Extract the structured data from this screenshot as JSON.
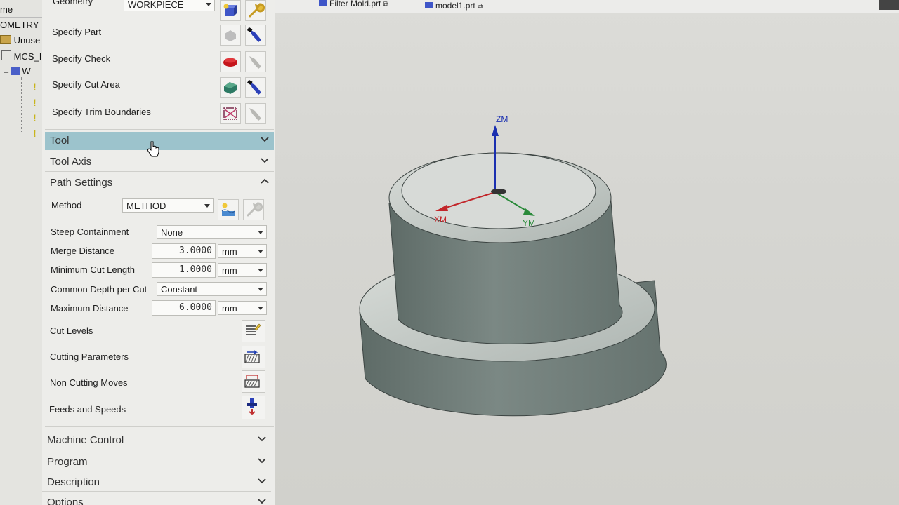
{
  "tree": {
    "items": [
      {
        "label": "me"
      },
      {
        "label": "OMETRY"
      },
      {
        "label": "Unuse"
      },
      {
        "label": "MCS_I"
      },
      {
        "label": "W"
      }
    ]
  },
  "tabs": [
    {
      "label": "Filter Mold.prt"
    },
    {
      "label": "model1.prt"
    }
  ],
  "geometry": {
    "label": "Geometry",
    "value": "WORKPIECE",
    "specify": [
      {
        "label": "Specify Part"
      },
      {
        "label": "Specify Check"
      },
      {
        "label": "Specify Cut Area"
      },
      {
        "label": "Specify Trim Boundaries"
      }
    ]
  },
  "sections": {
    "tool": "Tool",
    "tool_axis": "Tool Axis",
    "path_settings": "Path Settings",
    "machine_control": "Machine Control",
    "program": "Program",
    "description": "Description",
    "options": "Options"
  },
  "path": {
    "method_label": "Method",
    "method_value": "METHOD",
    "steep_label": "Steep Containment",
    "steep_value": "None",
    "merge_label": "Merge Distance",
    "merge_value": "3.0000",
    "merge_unit": "mm",
    "mincut_label": "Minimum Cut Length",
    "mincut_value": "1.0000",
    "mincut_unit": "mm",
    "depth_label": "Common Depth per Cut",
    "depth_value": "Constant",
    "maxdist_label": "Maximum Distance",
    "maxdist_value": "6.0000",
    "maxdist_unit": "mm",
    "cut_levels": "Cut Levels",
    "cutting_params": "Cutting Parameters",
    "non_cutting": "Non Cutting Moves",
    "feeds": "Feeds and Speeds"
  },
  "axes": {
    "zm": "ZM",
    "xm": "XM",
    "ym": "YM"
  },
  "colors": {
    "accent_header": "#9cc3cc",
    "model_body": "#6f7c78",
    "axis_z": "#1a2fb0",
    "axis_x": "#c2262a",
    "axis_y": "#2a8a3a"
  }
}
